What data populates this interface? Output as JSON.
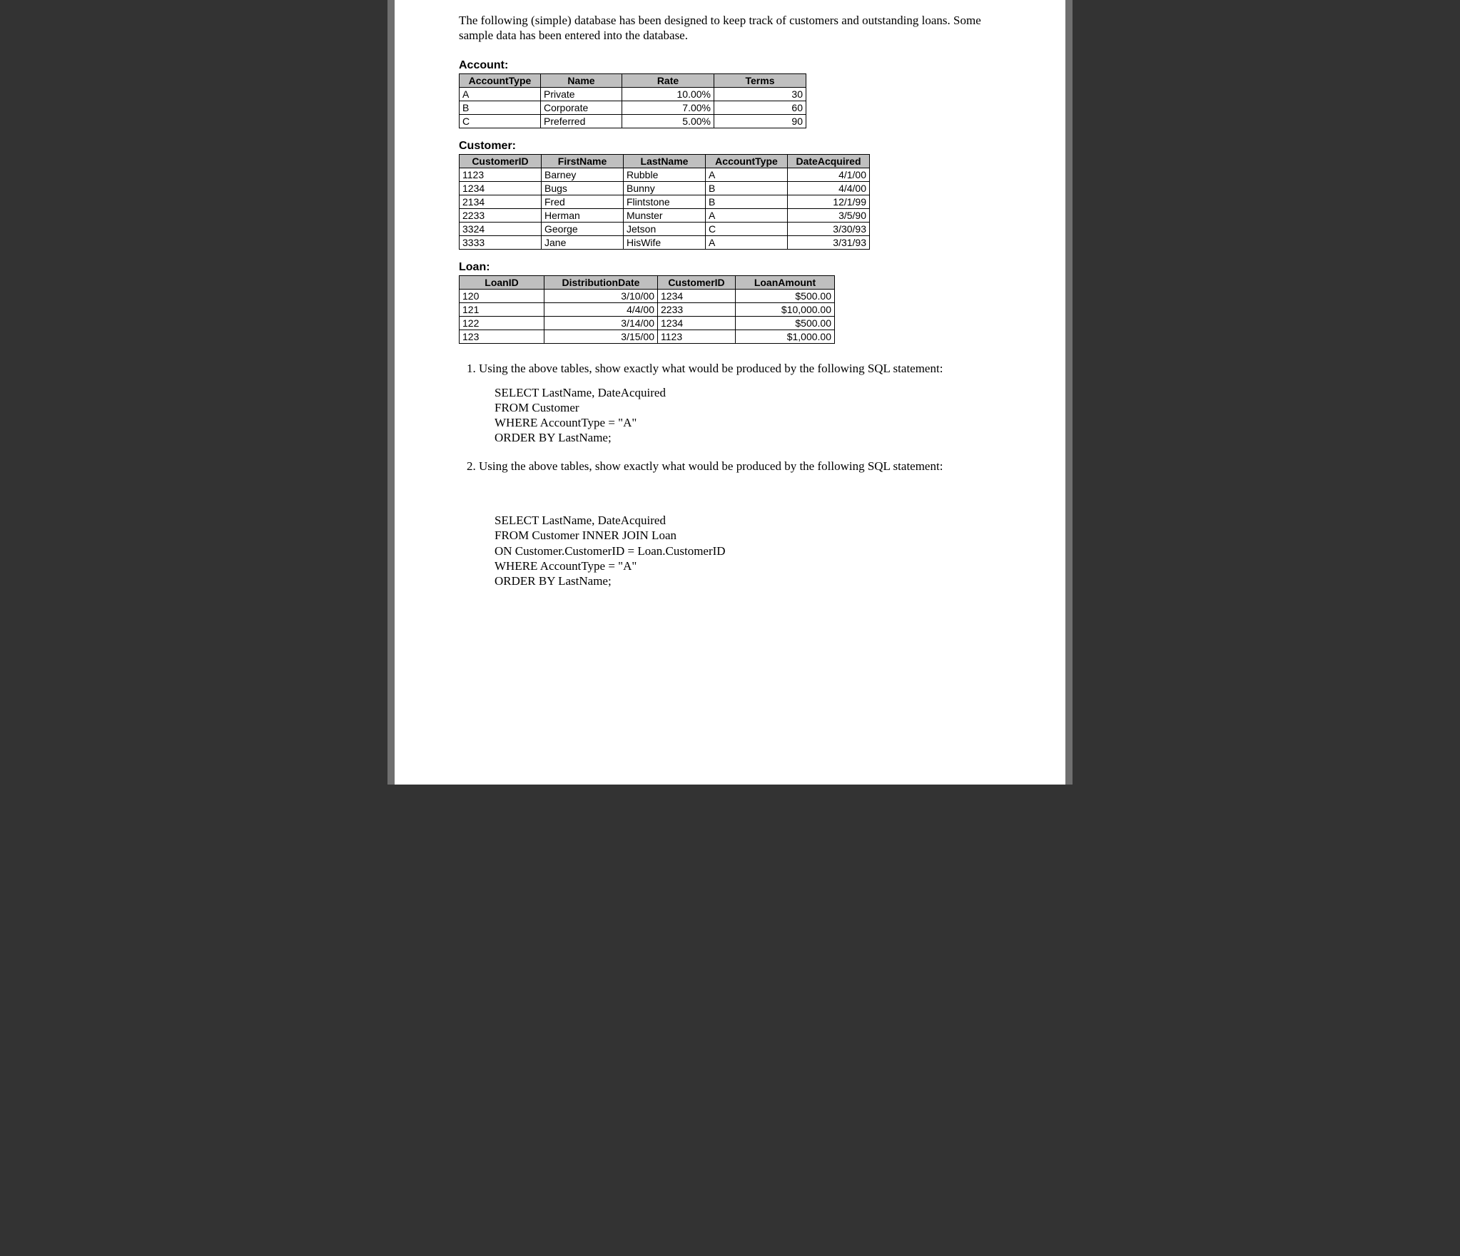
{
  "intro": "The following (simple) database has been designed to keep track of customers and outstanding loans.  Some sample data has been entered into the database.",
  "tables": {
    "account": {
      "title": "Account:",
      "headers": [
        "AccountType",
        "Name",
        "Rate",
        "Terms"
      ],
      "rows": [
        {
          "type": "A",
          "name": "Private",
          "rate": "10.00%",
          "terms": "30"
        },
        {
          "type": "B",
          "name": "Corporate",
          "rate": "7.00%",
          "terms": "60"
        },
        {
          "type": "C",
          "name": "Preferred",
          "rate": "5.00%",
          "terms": "90"
        }
      ]
    },
    "customer": {
      "title": "Customer:",
      "headers": [
        "CustomerID",
        "FirstName",
        "LastName",
        "AccountType",
        "DateAcquired"
      ],
      "rows": [
        {
          "id": "1123",
          "first": "Barney",
          "last": "Rubble",
          "type": "A",
          "date": "4/1/00"
        },
        {
          "id": "1234",
          "first": "Bugs",
          "last": "Bunny",
          "type": "B",
          "date": "4/4/00"
        },
        {
          "id": "2134",
          "first": "Fred",
          "last": "Flintstone",
          "type": "B",
          "date": "12/1/99"
        },
        {
          "id": "2233",
          "first": "Herman",
          "last": "Munster",
          "type": "A",
          "date": "3/5/90"
        },
        {
          "id": "3324",
          "first": "George",
          "last": "Jetson",
          "type": "C",
          "date": "3/30/93"
        },
        {
          "id": "3333",
          "first": "Jane",
          "last": "HisWife",
          "type": "A",
          "date": "3/31/93"
        }
      ]
    },
    "loan": {
      "title": "Loan:",
      "headers": [
        "LoanID",
        "DistributionDate",
        "CustomerID",
        "LoanAmount"
      ],
      "rows": [
        {
          "id": "120",
          "date": "3/10/00",
          "cust": "1234",
          "amount": "$500.00"
        },
        {
          "id": "121",
          "date": "4/4/00",
          "cust": "2233",
          "amount": "$10,000.00"
        },
        {
          "id": "122",
          "date": "3/14/00",
          "cust": "1234",
          "amount": "$500.00"
        },
        {
          "id": "123",
          "date": "3/15/00",
          "cust": "1123",
          "amount": "$1,000.00"
        }
      ]
    }
  },
  "questions": {
    "q1": {
      "prompt": "Using the above tables, show exactly what would be produced by the following SQL statement:",
      "sql": "SELECT LastName, DateAcquired\nFROM Customer\nWHERE AccountType = \"A\"\nORDER BY LastName;"
    },
    "q2": {
      "prompt": "Using the above tables, show exactly what would be produced by the following SQL statement:",
      "sql": "SELECT LastName, DateAcquired\nFROM Customer INNER JOIN Loan\nON Customer.CustomerID = Loan.CustomerID\nWHERE AccountType = \"A\"\nORDER BY LastName;"
    }
  }
}
